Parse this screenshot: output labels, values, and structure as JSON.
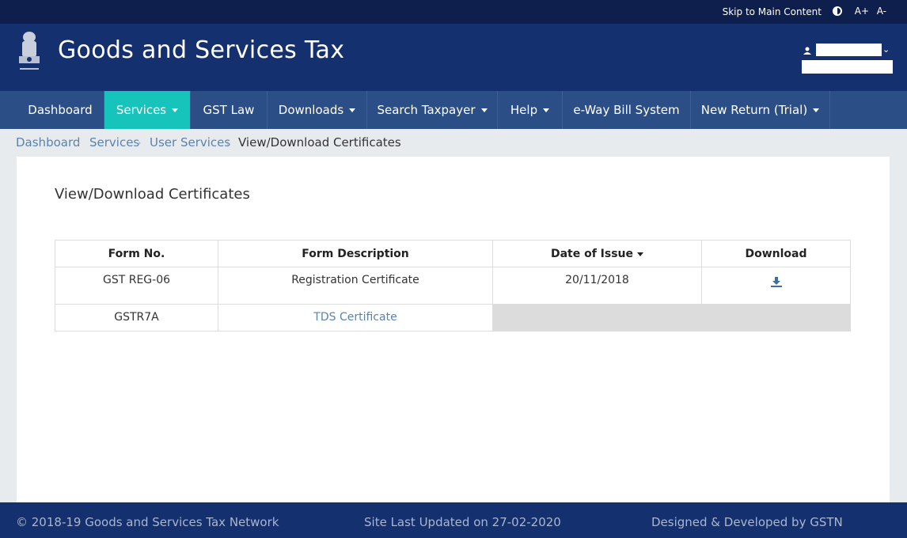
{
  "topbar": {
    "skip_label": "Skip to Main Content",
    "font_increase": "A+",
    "font_decrease": "A-"
  },
  "header": {
    "title": "Goods and Services Tax"
  },
  "nav": {
    "items": [
      {
        "label": "Dashboard"
      },
      {
        "label": "Services"
      },
      {
        "label": "GST Law"
      },
      {
        "label": "Downloads"
      },
      {
        "label": "Search Taxpayer"
      },
      {
        "label": "Help"
      },
      {
        "label": "e-Way Bill System"
      },
      {
        "label": "New Return (Trial)"
      }
    ]
  },
  "breadcrumb": {
    "items": [
      "Dashboard",
      "Services",
      "User Services",
      "View/Download Certificates"
    ]
  },
  "page": {
    "title": "View/Download Certificates"
  },
  "table": {
    "headers": [
      "Form No.",
      "Form Description",
      "Date of Issue",
      "Download"
    ],
    "rows": [
      {
        "form_no": "GST REG-06",
        "description": "Registration Certificate",
        "date": "20/11/2018"
      },
      {
        "form_no": "GSTR7A",
        "description": "TDS Certificate",
        "date": ""
      }
    ]
  },
  "footer": {
    "copyright": "© 2018-19 Goods and Services Tax Network",
    "updated": "Site Last Updated on 27-02-2020",
    "developer": "Designed & Developed by GSTN"
  },
  "colors": {
    "topbar": "#0e1f4d",
    "header": "#14306e",
    "navbar": "#2c4e86",
    "active_nav": "#17c4bb",
    "link": "#5b82ad"
  }
}
